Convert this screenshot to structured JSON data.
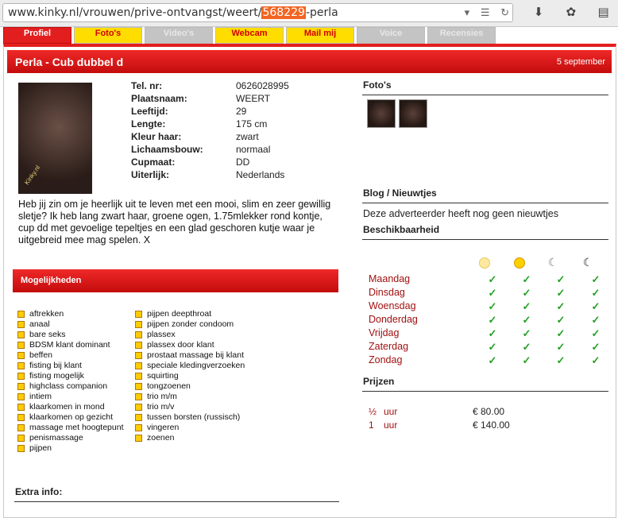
{
  "browser": {
    "url_pre": "www.kinky.nl/vrouwen/prive-ontvangst/weert/",
    "url_hl": "568229",
    "url_post": "-perla",
    "icons": [
      "dropdown-icon",
      "reader-icon",
      "reload-icon"
    ],
    "toolbar_icons": [
      "download-icon",
      "extension-icon",
      "clipboard-icon"
    ]
  },
  "tabs": [
    {
      "label": "Profiel",
      "state": "active"
    },
    {
      "label": "Foto's",
      "state": "yellow"
    },
    {
      "label": "Video's",
      "state": "disabled"
    },
    {
      "label": "Webcam",
      "state": "yellow"
    },
    {
      "label": "Mail mij",
      "state": "yellow"
    },
    {
      "label": "Voice",
      "state": "disabled"
    },
    {
      "label": "Recensies",
      "state": "disabled"
    }
  ],
  "profile": {
    "title": "Perla - Cub dubbel d",
    "date": "5 september",
    "watermark": "Kinky.nl",
    "info": [
      {
        "k": "Tel. nr:",
        "v": "0626028995"
      },
      {
        "k": "Plaatsnaam:",
        "v": "WEERT"
      },
      {
        "k": "Leeftijd:",
        "v": "29"
      },
      {
        "k": "Lengte:",
        "v": "175 cm"
      },
      {
        "k": "Kleur haar:",
        "v": "zwart"
      },
      {
        "k": "Lichaamsbouw:",
        "v": "normaal"
      },
      {
        "k": "Cupmaat:",
        "v": "DD"
      },
      {
        "k": "Uiterlijk:",
        "v": "Nederlands"
      }
    ],
    "description": "Heb jij zin om je heerlijk uit te leven met een mooi, slim en zeer gewillig sletje? Ik heb lang zwart haar, groene ogen, 1.75mlekker rond kontje, cup dd met gevoelige tepeltjes en een glad geschoren kutje waar je uitgebreid mee mag spelen. X"
  },
  "mogelijkheden": {
    "title": "Mogelijkheden",
    "col1": [
      "aftrekken",
      "anaal",
      "bare seks",
      "BDSM klant dominant",
      "beffen",
      "fisting bij klant",
      "fisting mogelijk",
      "highclass companion",
      "intiem",
      "klaarkomen in mond",
      "klaarkomen op gezicht",
      "massage met hoogtepunt",
      "penismassage",
      "pijpen"
    ],
    "col2": [
      "pijpen deepthroat",
      "pijpen zonder condoom",
      "plassex",
      "plassex door klant",
      "prostaat massage bij klant",
      "speciale kledingverzoeken",
      "squirting",
      "tongzoenen",
      "trio m/m",
      "trio m/v",
      "tussen borsten (russisch)",
      "vingeren",
      "zoenen"
    ]
  },
  "extra_info": "Extra info:",
  "sidebar": {
    "fotos_title": "Foto's",
    "blog_title": "Blog / Nieuwtjes",
    "blog_text": "Deze adverteerder heeft nog geen nieuwtjes",
    "beschik_title": "Beschikbaarheid",
    "time_icons": [
      "morning-sun-icon",
      "afternoon-sun-icon",
      "evening-moon-icon",
      "night-moon-icon"
    ],
    "days": [
      "Maandag",
      "Dinsdag",
      "Woensdag",
      "Donderdag",
      "Vrijdag",
      "Zaterdag",
      "Zondag"
    ],
    "check": "✓",
    "prijzen_title": "Prijzen",
    "prices": [
      {
        "dur": "½",
        "unit": "uur",
        "price": "€ 80.00"
      },
      {
        "dur": "1",
        "unit": "uur",
        "price": "€ 140.00"
      }
    ]
  },
  "colors": {
    "accent": "#e31e1e",
    "tab_yellow": "#ffdd00",
    "check_green": "#25a025",
    "day_red": "#a01010"
  }
}
